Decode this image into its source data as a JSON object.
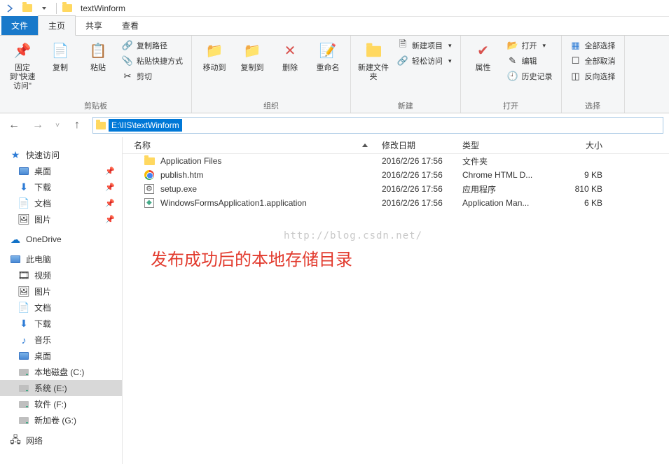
{
  "title": "textWinform",
  "tabs": {
    "file": "文件",
    "home": "主页",
    "share": "共享",
    "view": "查看"
  },
  "ribbon": {
    "pin": "固定到\"快速访问\"",
    "copy": "复制",
    "paste": "粘贴",
    "copypath": "复制路径",
    "pasteshortcut": "粘贴快捷方式",
    "cut": "剪切",
    "clipboard_group": "剪贴板",
    "moveto": "移动到",
    "copyto": "复制到",
    "delete": "删除",
    "rename": "重命名",
    "organize_group": "组织",
    "newfolder": "新建文件夹",
    "newitem": "新建项目",
    "easyaccess": "轻松访问",
    "new_group": "新建",
    "properties": "属性",
    "open": "打开",
    "edit": "编辑",
    "history": "历史记录",
    "open_group": "打开",
    "selectall": "全部选择",
    "selectnone": "全部取消",
    "invert": "反向选择",
    "select_group": "选择"
  },
  "address": {
    "path": "E:\\IIS\\textWinform"
  },
  "sidebar": {
    "quickaccess": "快速访问",
    "desktop": "桌面",
    "downloads": "下载",
    "documents": "文档",
    "pictures": "图片",
    "onedrive": "OneDrive",
    "thispc": "此电脑",
    "videos": "视频",
    "pictures2": "图片",
    "documents2": "文档",
    "downloads2": "下载",
    "music": "音乐",
    "desktop2": "桌面",
    "localc": "本地磁盘 (C:)",
    "systeme": "系统 (E:)",
    "softf": "软件 (F:)",
    "newg": "新加卷 (G:)",
    "network": "网络"
  },
  "columns": {
    "name": "名称",
    "date": "修改日期",
    "type": "类型",
    "size": "大小"
  },
  "files": [
    {
      "name": "Application Files",
      "date": "2016/2/26 17:56",
      "type": "文件夹",
      "size": ""
    },
    {
      "name": "publish.htm",
      "date": "2016/2/26 17:56",
      "type": "Chrome HTML D...",
      "size": "9 KB"
    },
    {
      "name": "setup.exe",
      "date": "2016/2/26 17:56",
      "type": "应用程序",
      "size": "810 KB"
    },
    {
      "name": "WindowsFormsApplication1.application",
      "date": "2016/2/26 17:56",
      "type": "Application Man...",
      "size": "6 KB"
    }
  ],
  "watermark": "http://blog.csdn.net/",
  "annotation": "发布成功后的本地存储目录"
}
